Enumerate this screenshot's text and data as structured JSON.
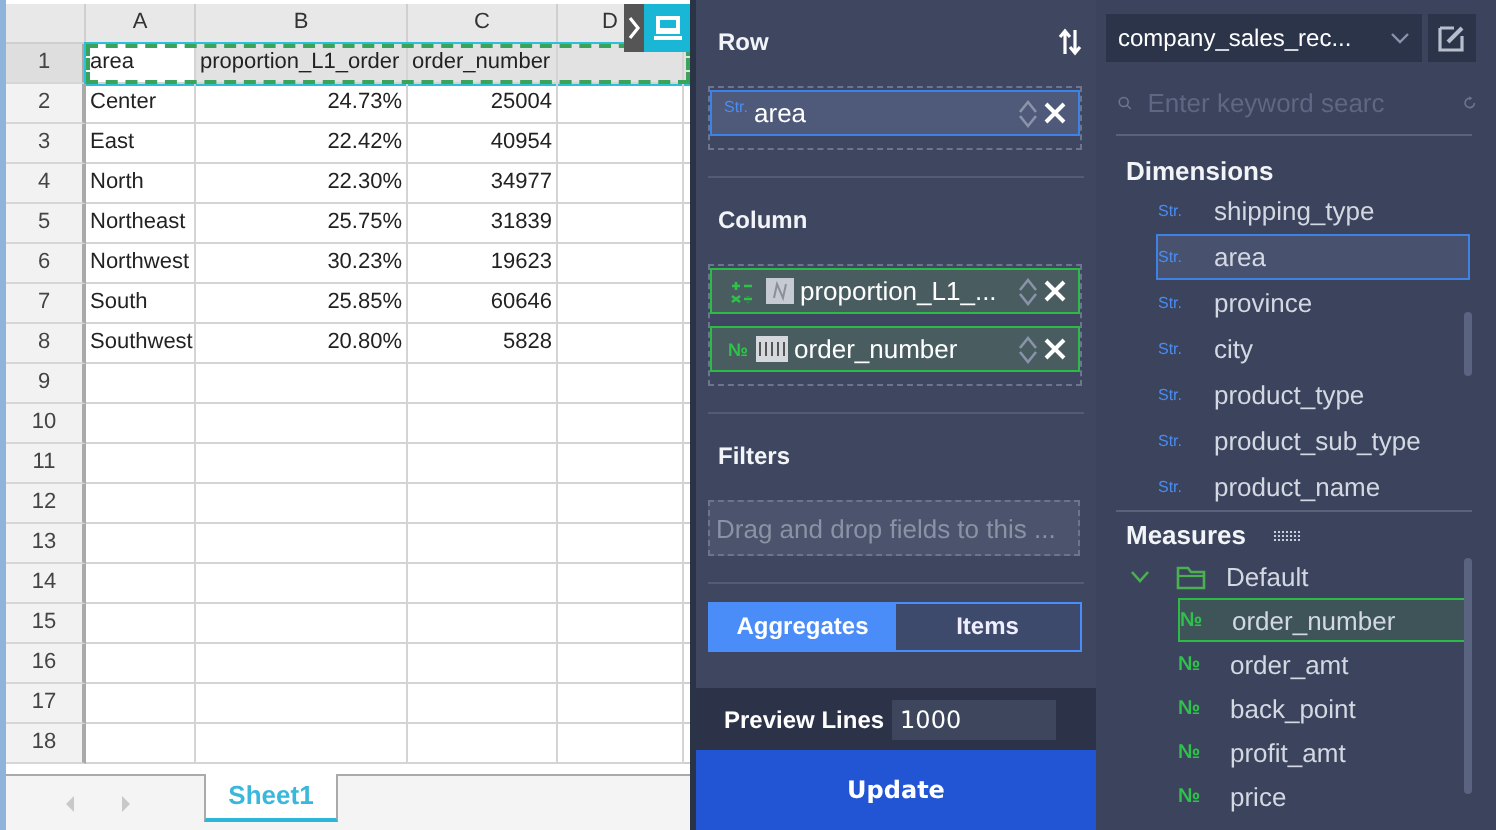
{
  "sheet": {
    "columns": [
      "A",
      "B",
      "C",
      "D"
    ],
    "rows": [
      {
        "number": "1",
        "selected": true,
        "cells": [
          {
            "text": "area",
            "kind": "text"
          },
          {
            "text": "proportion_L1_order",
            "kind": "text"
          },
          {
            "text": "order_number",
            "kind": "text"
          }
        ]
      },
      {
        "number": "2",
        "selected": false,
        "cells": [
          {
            "text": "Center",
            "kind": "text"
          },
          {
            "text": "24.73%",
            "kind": "number"
          },
          {
            "text": "25004",
            "kind": "number"
          }
        ]
      },
      {
        "number": "3",
        "selected": false,
        "cells": [
          {
            "text": "East",
            "kind": "text"
          },
          {
            "text": "22.42%",
            "kind": "number"
          },
          {
            "text": "40954",
            "kind": "number"
          }
        ]
      },
      {
        "number": "4",
        "selected": false,
        "cells": [
          {
            "text": "North",
            "kind": "text"
          },
          {
            "text": "22.30%",
            "kind": "number"
          },
          {
            "text": "34977",
            "kind": "number"
          }
        ]
      },
      {
        "number": "5",
        "selected": false,
        "cells": [
          {
            "text": "Northeast",
            "kind": "text"
          },
          {
            "text": "25.75%",
            "kind": "number"
          },
          {
            "text": "31839",
            "kind": "number"
          }
        ]
      },
      {
        "number": "6",
        "selected": false,
        "cells": [
          {
            "text": "Northwest",
            "kind": "text"
          },
          {
            "text": "30.23%",
            "kind": "number"
          },
          {
            "text": "19623",
            "kind": "number"
          }
        ]
      },
      {
        "number": "7",
        "selected": false,
        "cells": [
          {
            "text": "South",
            "kind": "text"
          },
          {
            "text": "25.85%",
            "kind": "number"
          },
          {
            "text": "60646",
            "kind": "number"
          }
        ]
      },
      {
        "number": "8",
        "selected": false,
        "cells": [
          {
            "text": "Southwest",
            "kind": "text"
          },
          {
            "text": "20.80%",
            "kind": "number"
          },
          {
            "text": "5828",
            "kind": "number"
          }
        ]
      },
      {
        "number": "9",
        "selected": false
      },
      {
        "number": "10",
        "selected": false
      },
      {
        "number": "11",
        "selected": false
      },
      {
        "number": "12",
        "selected": false
      },
      {
        "number": "13",
        "selected": false
      },
      {
        "number": "14",
        "selected": false
      },
      {
        "number": "15",
        "selected": false
      },
      {
        "number": "16",
        "selected": false
      },
      {
        "number": "17",
        "selected": false
      },
      {
        "number": "18",
        "selected": false
      }
    ],
    "tabs": [
      {
        "label": "Sheet1",
        "selected": true
      }
    ]
  },
  "row_section": {
    "title": "Row",
    "fields": [
      {
        "kind": "dimension",
        "type_tag": "Str.",
        "name": "area"
      }
    ]
  },
  "column_section": {
    "title": "Column",
    "fields": [
      {
        "kind": "calculated",
        "name": "proportion_L1_..."
      },
      {
        "kind": "measure",
        "type_tag": "№",
        "name": "order_number"
      }
    ]
  },
  "filters": {
    "title": "Filters",
    "placeholder": "Drag and drop fields to this ..."
  },
  "mode_tabs": [
    {
      "label": "Aggregates",
      "selected": true
    },
    {
      "label": "Items",
      "selected": false
    }
  ],
  "preview": {
    "label": "Preview Lines",
    "value": "1000"
  },
  "update_button": "Update",
  "dataset": "company_sales_rec...",
  "search": {
    "placeholder": "Enter keyword searc"
  },
  "dimensions": {
    "title": "Dimensions",
    "items": [
      {
        "type_tag": "Str.",
        "name": "shipping_type",
        "selected": false
      },
      {
        "type_tag": "Str.",
        "name": "area",
        "selected": true
      },
      {
        "type_tag": "Str.",
        "name": "province",
        "selected": false
      },
      {
        "type_tag": "Str.",
        "name": "city",
        "selected": false
      },
      {
        "type_tag": "Str.",
        "name": "product_type",
        "selected": false
      },
      {
        "type_tag": "Str.",
        "name": "product_sub_type",
        "selected": false
      },
      {
        "type_tag": "Str.",
        "name": "product_name",
        "selected": false
      }
    ]
  },
  "measures": {
    "title": "Measures",
    "folders": [
      {
        "name": "Default",
        "expanded": true,
        "children": [
          {
            "type_tag": "№",
            "name": "order_number",
            "selected": true
          },
          {
            "type_tag": "№",
            "name": "order_amt",
            "selected": false
          },
          {
            "type_tag": "№",
            "name": "back_point",
            "selected": false
          },
          {
            "type_tag": "№",
            "name": "profit_amt",
            "selected": false
          },
          {
            "type_tag": "№",
            "name": "price",
            "selected": false
          }
        ]
      }
    ]
  }
}
